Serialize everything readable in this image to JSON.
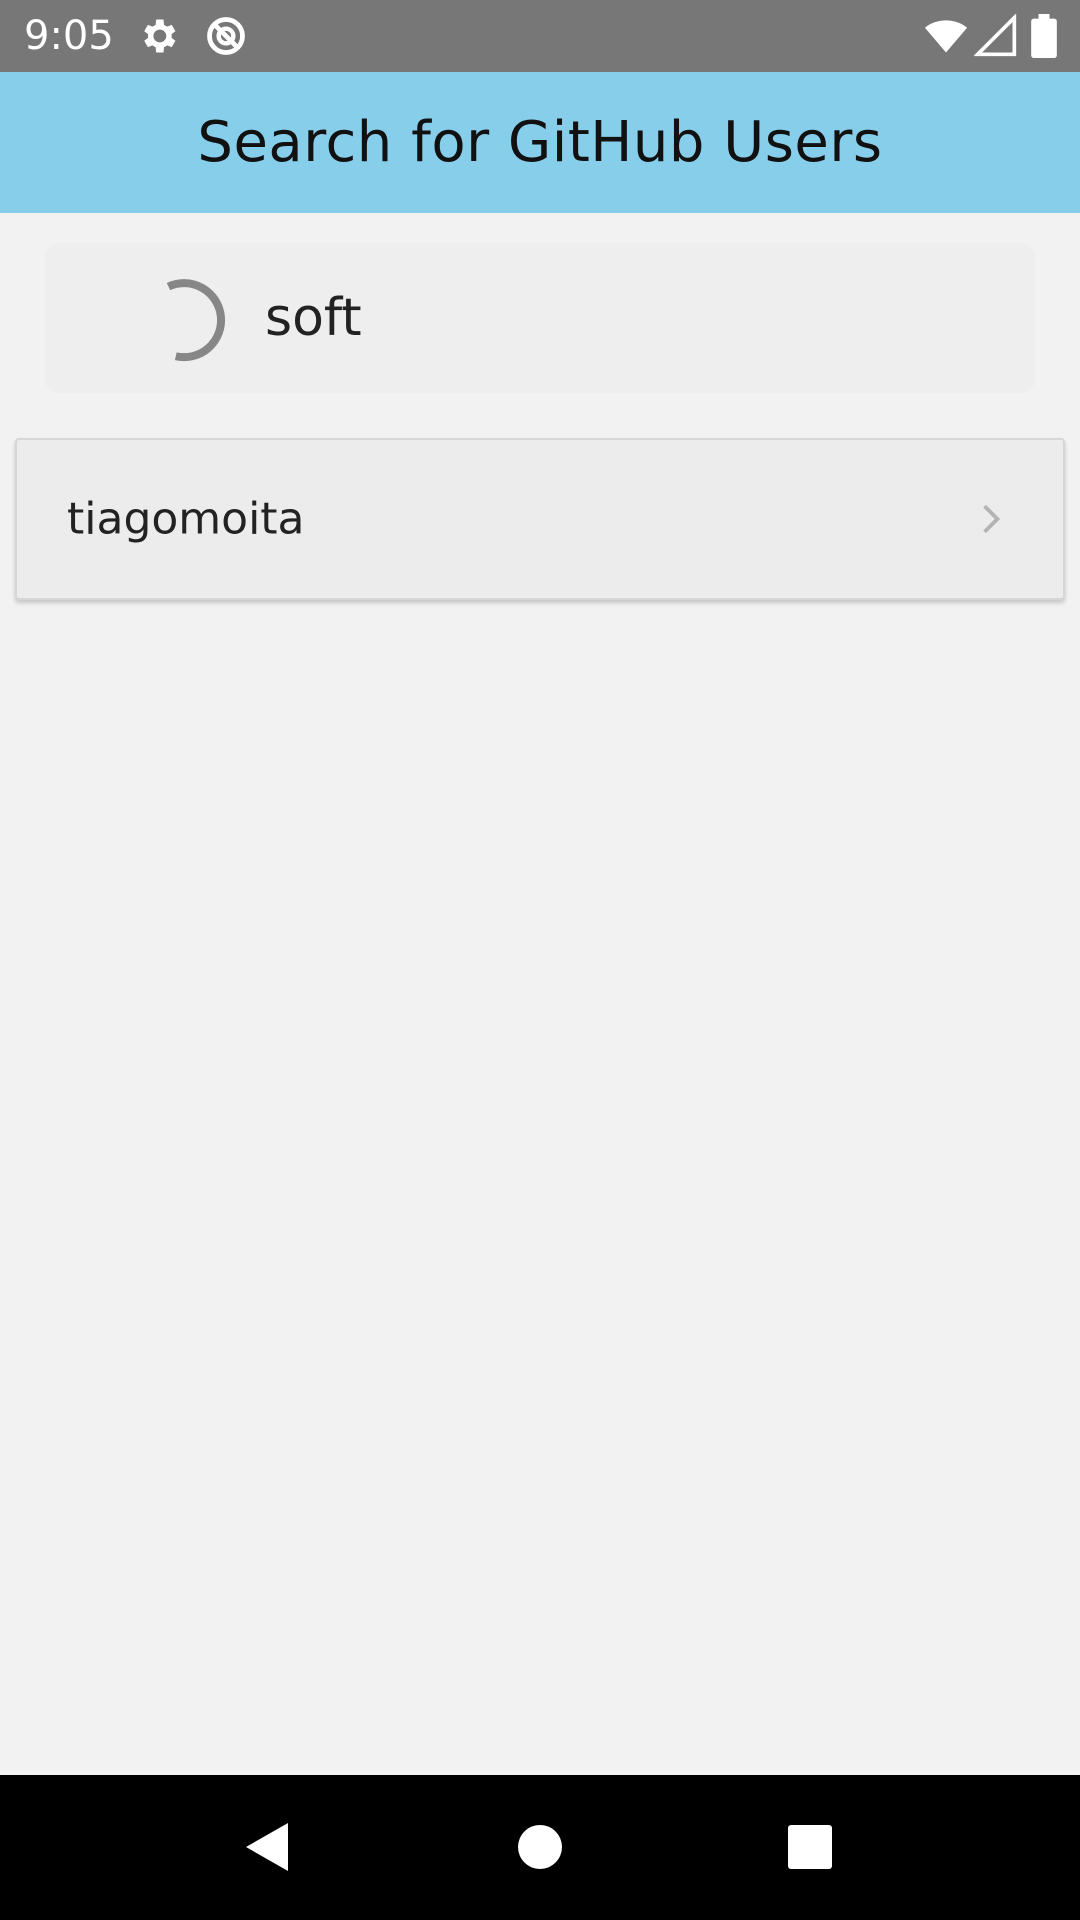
{
  "status_bar": {
    "time": "9:05",
    "icons": [
      "gear-icon",
      "no-sync-icon",
      "wifi-icon",
      "signal-icon",
      "battery-icon"
    ]
  },
  "app_bar": {
    "title": "Search for GitHub Users",
    "background_color": "#87ceeb"
  },
  "search": {
    "value": "soft",
    "loading": true
  },
  "results": [
    {
      "login": "tiagomoita"
    }
  ],
  "nav_bar": {
    "buttons": [
      "back-icon",
      "home-icon",
      "recents-icon"
    ]
  }
}
